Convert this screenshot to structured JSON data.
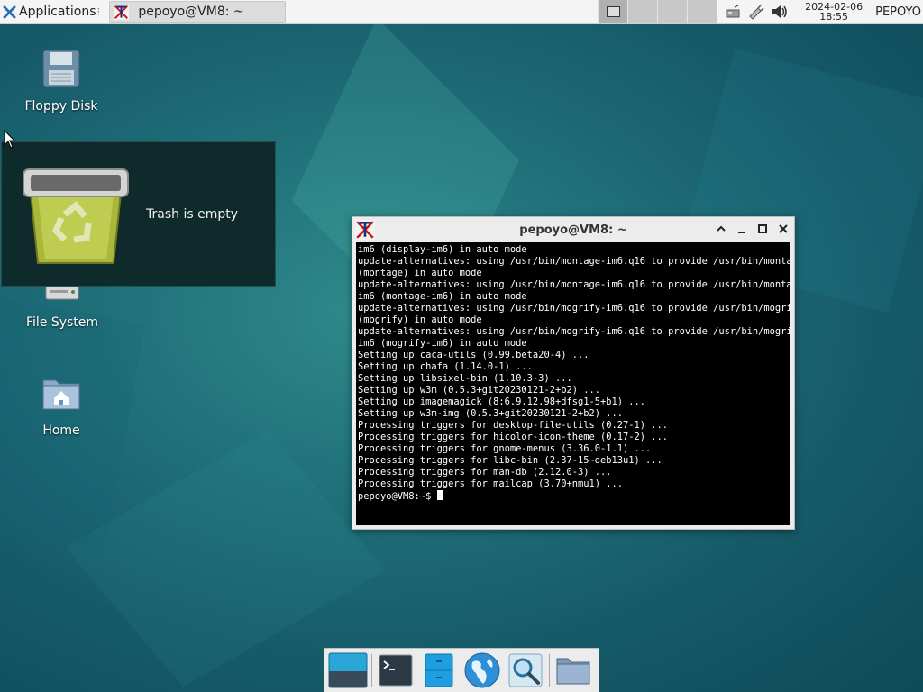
{
  "top_panel": {
    "applications_label": "Applications",
    "task_title": "pepoyo@VM8: ~",
    "clock_date": "2024-02-06",
    "clock_time": "18:55",
    "user": "PEPOYO"
  },
  "desktop": {
    "icons": [
      {
        "label": "Floppy Disk",
        "icon": "floppy-disk-icon"
      },
      {
        "label": "File System",
        "icon": "hard-drive-icon"
      },
      {
        "label": "Home",
        "icon": "home-folder-icon"
      }
    ],
    "trash_tooltip": "Trash is empty"
  },
  "terminal": {
    "title": "pepoyo@VM8: ~",
    "lines": [
      "im6 (display-im6) in auto mode",
      "update-alternatives: using /usr/bin/montage-im6.q16 to provide /usr/bin/montage",
      "(montage) in auto mode",
      "update-alternatives: using /usr/bin/montage-im6.q16 to provide /usr/bin/montage-",
      "im6 (montage-im6) in auto mode",
      "update-alternatives: using /usr/bin/mogrify-im6.q16 to provide /usr/bin/mogrify",
      "(mogrify) in auto mode",
      "update-alternatives: using /usr/bin/mogrify-im6.q16 to provide /usr/bin/mogrify-",
      "im6 (mogrify-im6) in auto mode",
      "Setting up caca-utils (0.99.beta20-4) ...",
      "Setting up chafa (1.14.0-1) ...",
      "Setting up libsixel-bin (1.10.3-3) ...",
      "Setting up w3m (0.5.3+git20230121-2+b2) ...",
      "Setting up imagemagick (8:6.9.12.98+dfsg1-5+b1) ...",
      "Setting up w3m-img (0.5.3+git20230121-2+b2) ...",
      "Processing triggers for desktop-file-utils (0.27-1) ...",
      "Processing triggers for hicolor-icon-theme (0.17-2) ...",
      "Processing triggers for gnome-menus (3.36.0-1.1) ...",
      "Processing triggers for libc-bin (2.37-15~deb13u1) ...",
      "Processing triggers for man-db (2.12.0-3) ...",
      "Processing triggers for mailcap (3.70+nmu1) ..."
    ],
    "prompt": "pepoyo@VM8:~$ "
  },
  "dock": {
    "items": [
      {
        "icon": "show-desktop-icon"
      },
      {
        "icon": "terminal-icon"
      },
      {
        "icon": "file-manager-icon"
      },
      {
        "icon": "web-browser-icon"
      },
      {
        "icon": "app-finder-icon"
      },
      {
        "icon": "folder-icon"
      }
    ]
  }
}
